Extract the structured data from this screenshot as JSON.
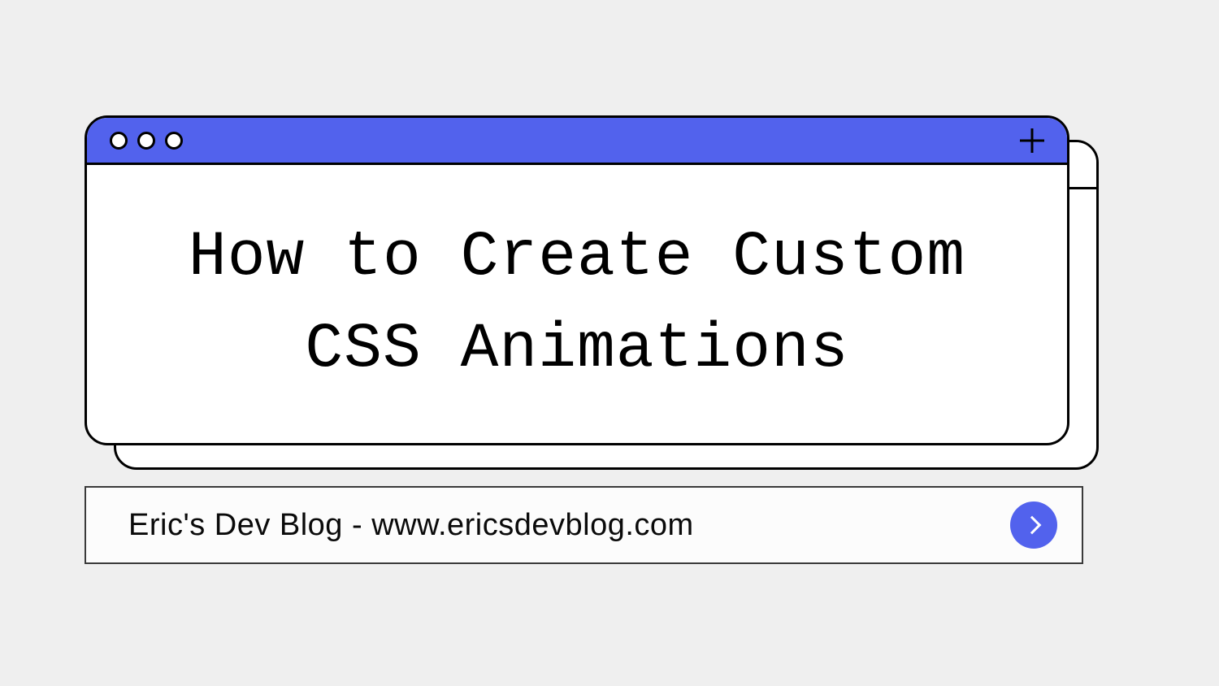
{
  "window": {
    "heading": "How to Create Custom CSS Animations"
  },
  "search": {
    "text": "Eric's Dev Blog - www.ericsdevblog.com"
  },
  "colors": {
    "accent": "#5262ed",
    "border": "#000000",
    "bg": "#efefef"
  }
}
